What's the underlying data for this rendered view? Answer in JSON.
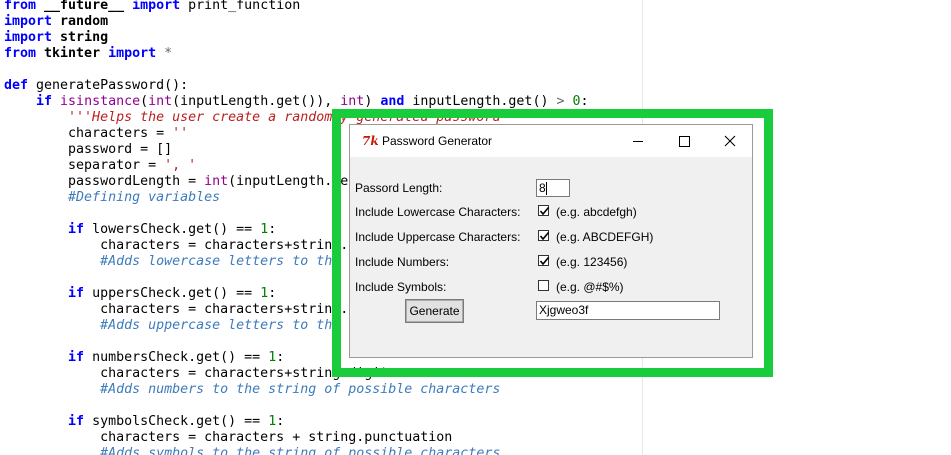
{
  "editor": {
    "lines": [
      {
        "segments": [
          {
            "t": "from ",
            "c": "kw"
          },
          {
            "t": "__future__ ",
            "c": "nm"
          },
          {
            "t": "import ",
            "c": "kw"
          },
          {
            "t": "print_function",
            "c": ""
          }
        ]
      },
      {
        "segments": [
          {
            "t": "import ",
            "c": "kw"
          },
          {
            "t": "random",
            "c": "nm"
          }
        ]
      },
      {
        "segments": [
          {
            "t": "import ",
            "c": "kw"
          },
          {
            "t": "string",
            "c": "nm"
          }
        ]
      },
      {
        "segments": [
          {
            "t": "from ",
            "c": "kw"
          },
          {
            "t": "tkinter ",
            "c": "nm"
          },
          {
            "t": "import ",
            "c": "kw"
          },
          {
            "t": "*",
            "c": "op"
          }
        ]
      },
      {
        "segments": []
      },
      {
        "segments": [
          {
            "t": "def ",
            "c": "kw"
          },
          {
            "t": "generatePassword",
            "c": ""
          },
          {
            "t": "():",
            "c": ""
          }
        ]
      },
      {
        "segments": [
          {
            "t": "    if ",
            "c": "kw"
          },
          {
            "t": "isinstance",
            "c": "bi"
          },
          {
            "t": "(",
            "c": ""
          },
          {
            "t": "int",
            "c": "bi"
          },
          {
            "t": "(inputLength.get()), ",
            "c": ""
          },
          {
            "t": "int",
            "c": "bi"
          },
          {
            "t": ") ",
            "c": ""
          },
          {
            "t": "and ",
            "c": "kw"
          },
          {
            "t": "inputLength.get() ",
            "c": ""
          },
          {
            "t": "> ",
            "c": "op"
          },
          {
            "t": "0",
            "c": "num"
          },
          {
            "t": ":",
            "c": ""
          }
        ]
      },
      {
        "segments": [
          {
            "t": "        '''Helps the user create a randomly generated password",
            "c": "str"
          }
        ]
      },
      {
        "segments": [
          {
            "t": "        characters = ",
            "c": ""
          },
          {
            "t": "''",
            "c": "sq"
          }
        ]
      },
      {
        "segments": [
          {
            "t": "        password = []",
            "c": ""
          }
        ]
      },
      {
        "segments": [
          {
            "t": "        separator = ",
            "c": ""
          },
          {
            "t": "', '",
            "c": "sq"
          }
        ]
      },
      {
        "segments": [
          {
            "t": "        passwordLength = ",
            "c": ""
          },
          {
            "t": "int",
            "c": "bi"
          },
          {
            "t": "(inputLength.get())",
            "c": ""
          }
        ]
      },
      {
        "segments": [
          {
            "t": "        #Defining variables",
            "c": "cmt"
          }
        ]
      },
      {
        "segments": []
      },
      {
        "segments": [
          {
            "t": "        if ",
            "c": "kw"
          },
          {
            "t": "lowersCheck.get() == ",
            "c": ""
          },
          {
            "t": "1",
            "c": "num"
          },
          {
            "t": ":",
            "c": ""
          }
        ]
      },
      {
        "segments": [
          {
            "t": "            characters = characters+string.ascii_lowercase",
            "c": ""
          }
        ]
      },
      {
        "segments": [
          {
            "t": "            #Adds lowercase letters to the string of possible characters",
            "c": "cmt"
          }
        ]
      },
      {
        "segments": []
      },
      {
        "segments": [
          {
            "t": "        if ",
            "c": "kw"
          },
          {
            "t": "uppersCheck.get() == ",
            "c": ""
          },
          {
            "t": "1",
            "c": "num"
          },
          {
            "t": ":",
            "c": ""
          }
        ]
      },
      {
        "segments": [
          {
            "t": "            characters = characters+string.ascii_uppercase",
            "c": ""
          }
        ]
      },
      {
        "segments": [
          {
            "t": "            #Adds uppercase letters to the string of possible characters",
            "c": "cmt"
          }
        ]
      },
      {
        "segments": []
      },
      {
        "segments": [
          {
            "t": "        if ",
            "c": "kw"
          },
          {
            "t": "numbersCheck.get() == ",
            "c": ""
          },
          {
            "t": "1",
            "c": "num"
          },
          {
            "t": ":",
            "c": ""
          }
        ]
      },
      {
        "segments": [
          {
            "t": "            characters = characters+string.digits",
            "c": ""
          }
        ]
      },
      {
        "segments": [
          {
            "t": "            #Adds numbers to the string of possible characters",
            "c": "cmt"
          }
        ]
      },
      {
        "segments": []
      },
      {
        "segments": [
          {
            "t": "        if ",
            "c": "kw"
          },
          {
            "t": "symbolsCheck.get() == ",
            "c": ""
          },
          {
            "t": "1",
            "c": "num"
          },
          {
            "t": ":",
            "c": ""
          }
        ]
      },
      {
        "segments": [
          {
            "t": "            characters = characters + string.punctuation",
            "c": ""
          }
        ]
      },
      {
        "segments": [
          {
            "t": "            #Adds symbols to the string of possible characters",
            "c": "cmt"
          }
        ]
      }
    ]
  },
  "window": {
    "icon_text": "7k",
    "title": "Password Generator",
    "controls": {
      "minimize": "minimize-icon",
      "maximize": "maximize-icon",
      "close": "close-icon"
    }
  },
  "form": {
    "length_label": "Passord Length:",
    "length_value": "8",
    "options": [
      {
        "label": "Include Lowercase Characters:",
        "checked": true,
        "hint": "(e.g. abcdefgh)"
      },
      {
        "label": "Include Uppercase Characters:",
        "checked": true,
        "hint": "(e.g. ABCDEFGH)"
      },
      {
        "label": "Include Numbers:",
        "checked": true,
        "hint": "(e.g. 123456)"
      },
      {
        "label": "Include Symbols:",
        "checked": false,
        "hint": "(e.g. @#$%)"
      }
    ],
    "generate_label": "Generate",
    "password_value": "Xjgweo3f"
  },
  "colors": {
    "highlight": "#19cc3b",
    "keyword": "#0000ff",
    "comment": "#3d7bbd",
    "string": "#ba2121"
  }
}
